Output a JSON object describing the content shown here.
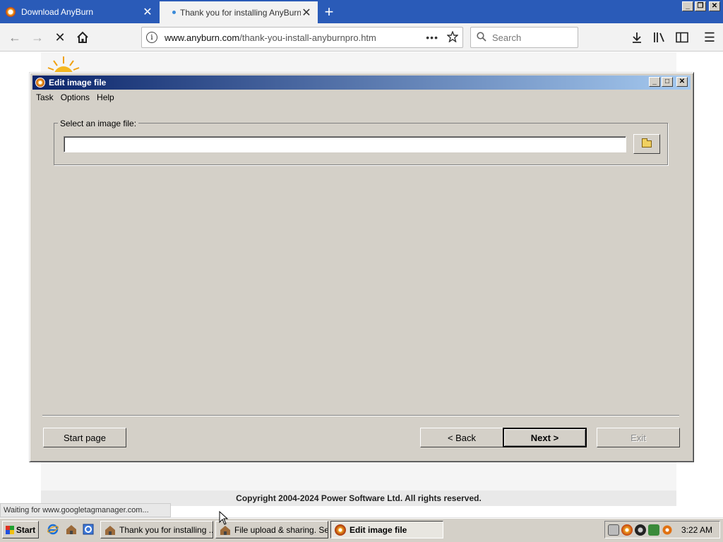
{
  "browser": {
    "tabs": [
      {
        "label": "Download AnyBurn"
      },
      {
        "label": "Thank you for installing AnyBurn P"
      }
    ],
    "new_tab_symbol": "+",
    "url_domain": "www.anyburn.com",
    "url_path": "/thank-you-install-anyburnpro.htm",
    "url_more": "•••",
    "search_placeholder": "Search",
    "status_text": "Waiting for www.googletagmanager.com..."
  },
  "page": {
    "copyright": "Copyright 2004-2024 Power Software Ltd. All rights reserved."
  },
  "dialog": {
    "title": "Edit image file",
    "menu": [
      "Task",
      "Options",
      "Help"
    ],
    "group_label": "Select an image file:",
    "file_value": "",
    "buttons": {
      "start_page": "Start page",
      "back": "< Back",
      "next": "Next >",
      "exit": "Exit"
    }
  },
  "taskbar": {
    "start": "Start",
    "tasks": [
      {
        "label": "Thank you for installing ..."
      },
      {
        "label": "File upload & sharing. Se..."
      },
      {
        "label": "Edit image file"
      }
    ],
    "clock": "3:22 AM"
  },
  "colors": {
    "titlebar_start": "#0a246a",
    "titlebar_end": "#a6caf0",
    "tabstrip": "#2a5bb8",
    "system_face": "#d4d0c8"
  }
}
